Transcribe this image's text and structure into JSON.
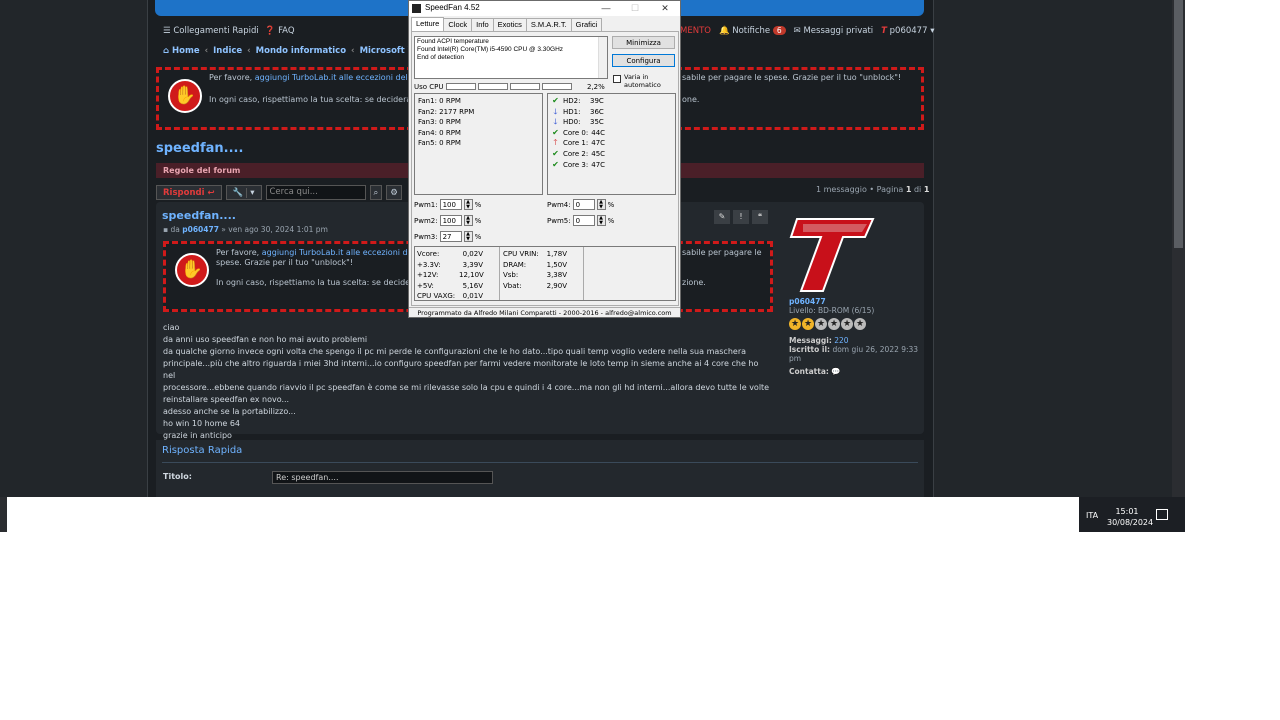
{
  "forum": {
    "nav_left": [
      "Collegamenti Rapidi",
      "FAQ"
    ],
    "nav_right": {
      "notifications_prefix": "MENTO",
      "notifications_label": "Notifiche",
      "notifications_count": "6",
      "messages_label": "Messaggi privati",
      "username": "p060477"
    },
    "breadcrumb": [
      "Home",
      "Indice",
      "Mondo informatico",
      "Microsoft Windo"
    ],
    "adblock_top": {
      "line1_a": "Per favore, ",
      "line1_link": "aggiungi TurboLab.it alle eccezioni del tu",
      "line1_b": "sabile per pagare le spese. Grazie per il tuo \"unblock\"!",
      "line2_a": "In ogni caso, rispettiamo la tua scelta: se deciderai",
      "line2_b": "one."
    },
    "page_title": "speedfan....",
    "rules_label": "Regole del forum",
    "reply_button": "Rispondi",
    "search_placeholder": "Cerca qui...",
    "pagination": {
      "a": "1 messaggio • Pagina ",
      "b": "1",
      "c": " di ",
      "d": "1"
    },
    "post": {
      "title": "speedfan....",
      "meta_a": "da ",
      "meta_user": "p060477",
      "meta_b": " » ven ago 30, 2024 1:01 pm",
      "adblock": {
        "line1_a": "Per favore, ",
        "line1_link": "aggiungi TurboLab.it alle eccezioni del",
        "line1_b": "sabile per pagare le",
        "line2": "spese. Grazie per il tuo \"unblock\"!",
        "line3_a": "In ogni caso, rispettiamo la tua scelta: se decidera",
        "line3_b": "zione."
      },
      "body": [
        "ciao",
        "da anni uso speedfan e non ho mai avuto problemi",
        "da qualche giorno invece ogni volta che spengo il pc mi perde le configurazioni che le ho dato...tipo quali temp voglio vedere nella sua maschera",
        "principale...più che altro riguarda i miei 3hd interni...io configuro speedfan per farmi vedere monitorate le loto temp in sieme anche ai 4 core che ho nel",
        "processore...ebbene quando riavvio il pc speedfan è come se mi rilevasse solo la cpu e quindi i 4 core...ma non gli hd interni...allora devo tutte le volte",
        "reinstallare speedfan ex novo...",
        "adesso anche se la portabilizzo...",
        "ho win 10 home 64",
        "grazie in anticipo"
      ]
    },
    "user": {
      "name": "p060477",
      "level": "Livello: BD-ROM (6/15)",
      "messages_label": "Messaggi:",
      "messages_value": "220",
      "joined_label": "Iscritto il:",
      "joined_value": "dom giu 26, 2022 9:33 pm",
      "contact_label": "Contatta:"
    },
    "quick_reply": {
      "title": "Risposta Rapida",
      "subject_label": "Titolo:",
      "subject_value": "Re: speedfan...."
    }
  },
  "taskbar": {
    "lang": "ITA",
    "time": "15:01",
    "date": "30/08/2024"
  },
  "speedfan": {
    "title": "SpeedFan 4.52",
    "tabs": [
      "Letture",
      "Clock",
      "Info",
      "Exotics",
      "S.M.A.R.T.",
      "Grafici"
    ],
    "log": [
      "Found ACPI temperature",
      "Found Intel(R) Core(TM) i5-4590 CPU @ 3.30GHz",
      "End of detection"
    ],
    "minimize_button": "Minimizza",
    "configure_button": "Configura",
    "auto_label_1": "Varia in",
    "auto_label_2": "automatico",
    "cpu_label": "Uso CPU",
    "cpu_value": "2,2%",
    "fans": [
      "Fan1: 0 RPM",
      "Fan2: 2177 RPM",
      "Fan3: 0 RPM",
      "Fan4: 0 RPM",
      "Fan5: 0 RPM"
    ],
    "temps": [
      {
        "name": "HD2:",
        "value": "39C",
        "icon": "check-icon"
      },
      {
        "name": "HD1:",
        "value": "36C",
        "icon": "arrow-down-icon"
      },
      {
        "name": "HD0:",
        "value": "35C",
        "icon": "arrow-down-icon"
      },
      {
        "name": "Core 0:",
        "value": "44C",
        "icon": "check-icon"
      },
      {
        "name": "Core 1:",
        "value": "47C",
        "icon": "arrow-up-icon"
      },
      {
        "name": "Core 2:",
        "value": "45C",
        "icon": "check-icon"
      },
      {
        "name": "Core 3:",
        "value": "47C",
        "icon": "check-icon"
      }
    ],
    "pwm": [
      {
        "label": "Pwm1:",
        "value": "100",
        "unit": "%"
      },
      {
        "label": "Pwm2:",
        "value": "100",
        "unit": "%"
      },
      {
        "label": "Pwm3:",
        "value": "27",
        "unit": "%"
      },
      {
        "label": "Pwm4:",
        "value": "0",
        "unit": "%"
      },
      {
        "label": "Pwm5:",
        "value": "0",
        "unit": "%"
      }
    ],
    "volts_left": [
      {
        "name": "Vcore:",
        "value": "0,02V"
      },
      {
        "name": "+3.3V:",
        "value": "3,39V"
      },
      {
        "name": "+12V:",
        "value": "12,10V"
      },
      {
        "name": "+5V:",
        "value": "5,16V"
      },
      {
        "name": "CPU VAXG:",
        "value": "0,01V"
      }
    ],
    "volts_right": [
      {
        "name": "CPU VRIN:",
        "value": "1,78V"
      },
      {
        "name": "DRAM:",
        "value": "1,50V"
      },
      {
        "name": "Vsb:",
        "value": "3,38V"
      },
      {
        "name": "Vbat:",
        "value": "2,90V"
      }
    ],
    "status": "Programmato da Alfredo Milani Comparetti - 2000-2016 - alfredo@almico.com"
  }
}
